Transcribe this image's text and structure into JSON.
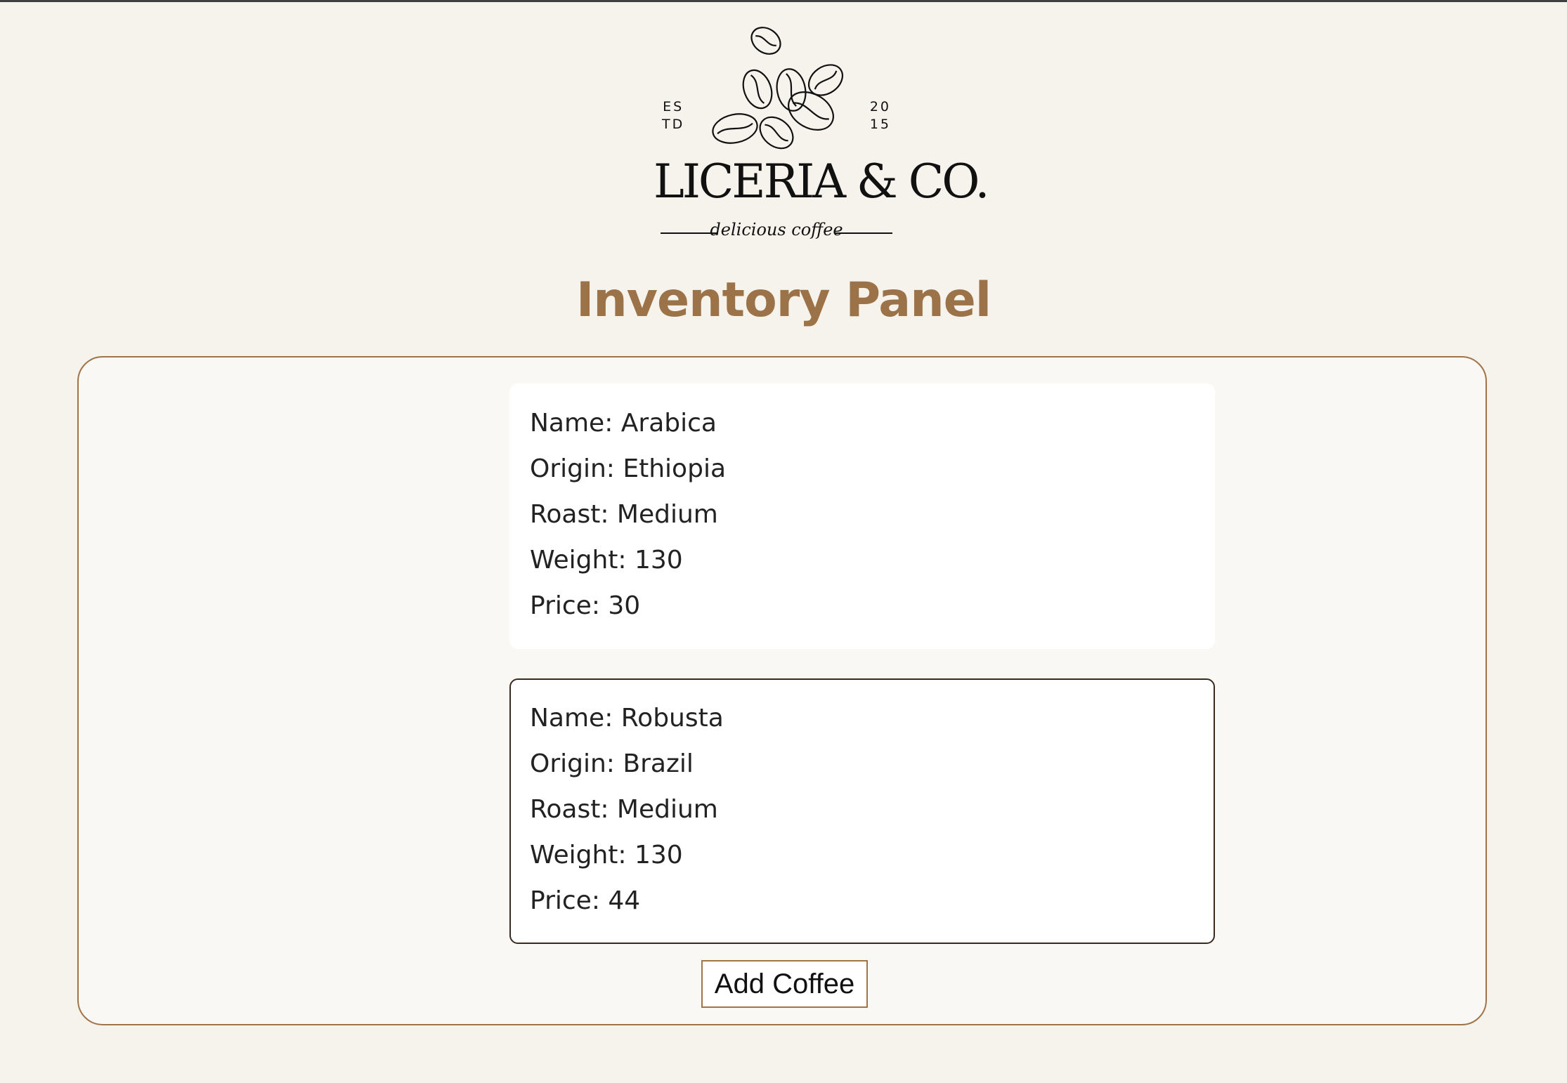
{
  "logo": {
    "est_left_line1": "ES",
    "est_left_line2": "TD",
    "est_right_line1": "20",
    "est_right_line2": "15",
    "brand": "LICERIA & CO.",
    "tagline": "delicious coffee"
  },
  "page": {
    "title": "Inventory Panel"
  },
  "inventory": {
    "items": [
      {
        "name": "Name: Arabica",
        "origin": "Origin: Ethiopia",
        "roast": "Roast: Medium",
        "weight": "Weight: 130",
        "price": "Price: 30"
      },
      {
        "name": "Name: Robusta",
        "origin": "Origin: Brazil",
        "roast": "Roast: Medium",
        "weight": "Weight: 130",
        "price": "Price: 44"
      }
    ],
    "add_button_label": "Add Coffee"
  },
  "colors": {
    "background": "#f6f3ed",
    "accent": "#9c7248",
    "panel_border": "#a07449",
    "selected_card_border": "#3a2a1c"
  },
  "icons": {
    "logo_art": "coffee-beans-icon"
  }
}
